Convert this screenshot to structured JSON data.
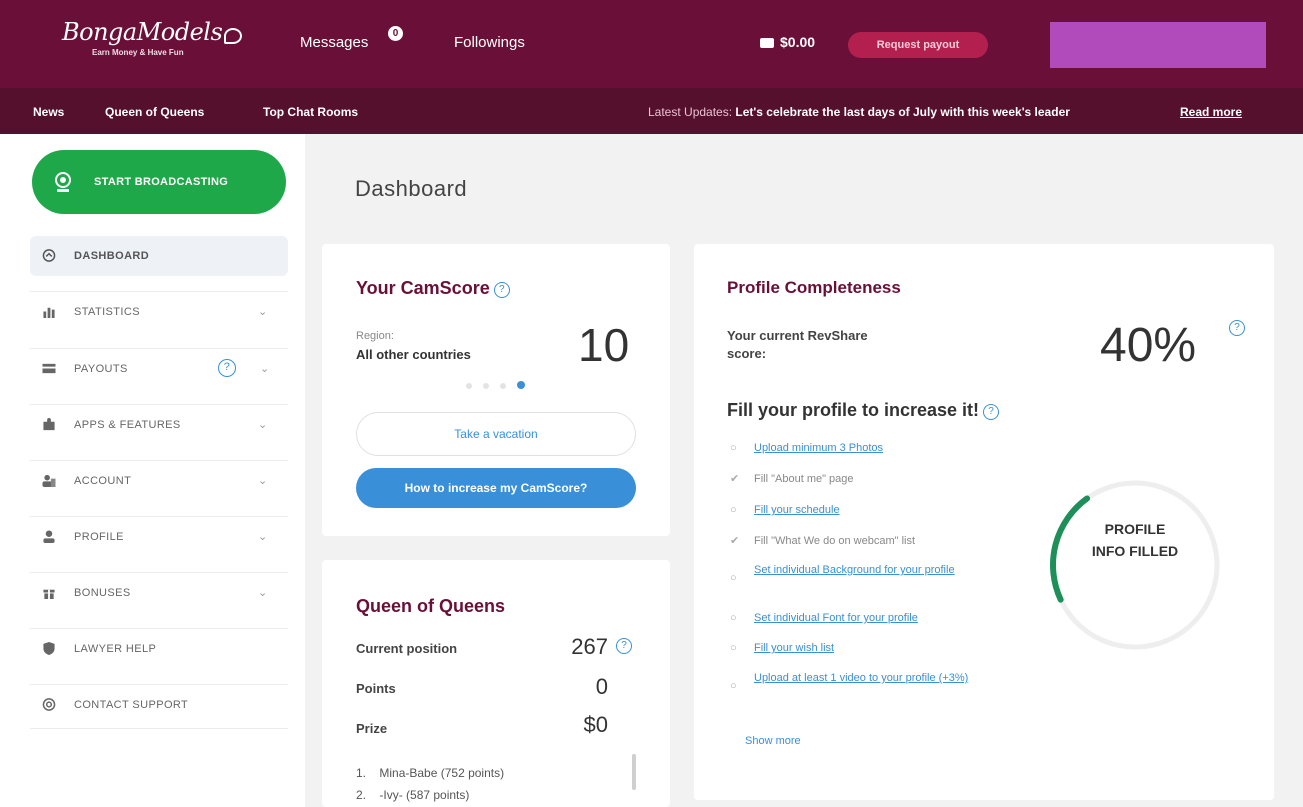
{
  "header": {
    "logo_text": "BongaModels",
    "logo_tagline": "Earn Money & Have Fun",
    "messages_label": "Messages",
    "messages_count": "0",
    "followings_label": "Followings",
    "balance": "$0.00",
    "payout_button": "Request payout"
  },
  "subnav": {
    "items": [
      "News",
      "Queen of Queens",
      "Top Chat Rooms"
    ],
    "latest_label": "Latest Updates:",
    "latest_text": "Let's celebrate the last days of July with this week's leader",
    "read_more": "Read more"
  },
  "sidebar": {
    "broadcast_button": "START BROADCASTING",
    "items": [
      {
        "label": "DASHBOARD",
        "icon": "dashboard-icon"
      },
      {
        "label": "STATISTICS",
        "icon": "bar-chart-icon"
      },
      {
        "label": "PAYOUTS",
        "icon": "wallet-icon"
      },
      {
        "label": "APPS & FEATURES",
        "icon": "puzzle-icon"
      },
      {
        "label": "ACCOUNT",
        "icon": "user-group-icon"
      },
      {
        "label": "PROFILE",
        "icon": "user-icon"
      },
      {
        "label": "BONUSES",
        "icon": "gift-icon"
      },
      {
        "label": "LAWYER HELP",
        "icon": "shield-icon"
      },
      {
        "label": "CONTACT SUPPORT",
        "icon": "support-icon"
      }
    ],
    "payouts_help": "?"
  },
  "main": {
    "title": "Dashboard",
    "camscore": {
      "title": "Your CamScore",
      "region_label": "Region:",
      "region_value": "All other countries",
      "score": "10",
      "vacation_button": "Take a vacation",
      "increase_button": "How to increase my CamScore?"
    },
    "queen": {
      "title": "Queen of Queens",
      "rows": [
        {
          "label": "Current position",
          "value": "267"
        },
        {
          "label": "Points",
          "value": "0"
        },
        {
          "label": "Prize",
          "value": "$0"
        }
      ],
      "leaders": [
        {
          "rank": "1.",
          "name": "Mina-Babe (752 points)"
        },
        {
          "rank": "2.",
          "name": "-Ivy- (587 points)"
        }
      ]
    },
    "profile": {
      "title": "Profile Completeness",
      "revshare_label": "Your current RevShare score:",
      "revshare_value": "40%",
      "fill_title": "Fill your profile to increase it!",
      "tasks": [
        {
          "text": "Upload minimum 3 Photos",
          "done": false
        },
        {
          "text": "Fill \"About me\" page",
          "done": true
        },
        {
          "text": "Fill your schedule",
          "done": false
        },
        {
          "text": "Fill \"What We do on webcam\" list",
          "done": true
        },
        {
          "text": "Set individual Background for your profile",
          "done": false
        },
        {
          "text": "Set individual Font for your profile",
          "done": false
        },
        {
          "text": "Fill your wish list",
          "done": false
        },
        {
          "text": "Upload at least 1 video to your profile (+3%)",
          "done": false
        }
      ],
      "show_more": "Show more",
      "ring_label_1": "PROFILE",
      "ring_label_2": "INFO FILLED",
      "completion": 0.4
    }
  }
}
